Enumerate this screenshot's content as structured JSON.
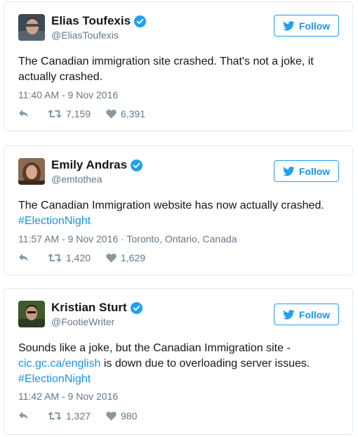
{
  "tweets": [
    {
      "name": "Elias Toufexis",
      "handle": "@EliasToufexis",
      "follow_label": "Follow",
      "text": "The Canadian immigration site crashed. That's not a joke, it actually crashed.",
      "timestamp": "11:40 AM - 9 Nov 2016",
      "retweets": "7,159",
      "likes": "6,391"
    },
    {
      "name": "Emily Andras",
      "handle": "@emtothea",
      "follow_label": "Follow",
      "text": "The Canadian Immigration website has now actually crashed.",
      "hashtag": "#ElectionNight",
      "timestamp": "11:57 AM - 9 Nov 2016",
      "location": "Toronto, Ontario, Canada",
      "retweets": "1,420",
      "likes": "1,629"
    },
    {
      "name": "Kristian Sturt",
      "handle": "@FootieWriter",
      "follow_label": "Follow",
      "text_before": "Sounds like a joke, but the Canadian Immigration site -",
      "link": "cic.gc.ca/english",
      "text_after": " is down due to overloading server issues.",
      "hashtag": "#ElectionNight",
      "timestamp": "11:42 AM - 9 Nov 2016",
      "retweets": "1,327",
      "likes": "980"
    }
  ],
  "colors": {
    "accent": "#1b95e0",
    "muted": "#657786",
    "border": "#e1e8ed"
  },
  "icons": [
    "verified-badge-icon",
    "twitter-bird-icon",
    "reply-icon",
    "retweet-icon",
    "heart-icon"
  ]
}
